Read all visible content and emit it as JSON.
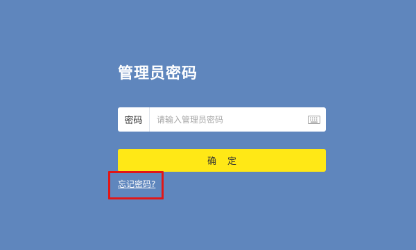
{
  "login": {
    "title": "管理员密码",
    "password_label": "密码",
    "password_value": "",
    "password_placeholder": "请输入管理员密码",
    "keyboard_icon": "keyboard-icon",
    "confirm_label": "确定",
    "forgot_password_link": "忘记密码?"
  },
  "colors": {
    "background": "#5f86bd",
    "confirm_button": "#ffe816",
    "highlight": "#e11616"
  }
}
